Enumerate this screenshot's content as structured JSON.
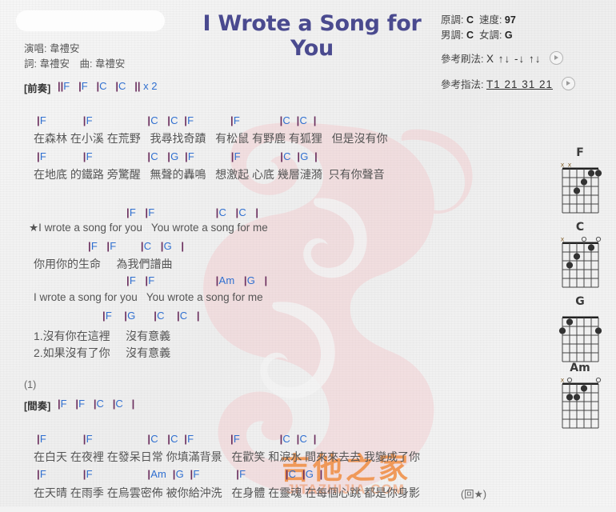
{
  "header": {
    "title": "I Wrote a Song for You",
    "singer_label": "演唱:",
    "singer": "韋禮安",
    "credits": "詞: 韋禮安　曲: 韋禮安",
    "redacted": ""
  },
  "info": {
    "original_key_label": "原調:",
    "original_key": "C",
    "tempo_label": "速度:",
    "tempo": "97",
    "male_key_label": "男調:",
    "male_key": "C",
    "female_key_label": "女調:",
    "female_key": "G",
    "strum_label": "參考刷法:",
    "strum_pattern": "X ↑↓ -↓ ↑↓",
    "pick_label": "參考指法:",
    "pick_pattern": "T1 21 31 21",
    "play_icon": "play-icon"
  },
  "sections": {
    "intro_tag": "[前奏]",
    "intro_chords": "||F   |F   |C   |C   || x 2",
    "interlude_tag": "[間奏]",
    "interlude_chords": "|F   |F   |C   |C   |",
    "repeat_note": "(1)",
    "return_note": "(回★)"
  },
  "verse1": {
    "line1_chords": "|F            |F                  |C   |C  |F            |F             |C  |C  |",
    "line1_lyric": "在森林 在小溪 在荒野   我尋找奇蹟   有松鼠 有野鹿 有狐狸   但是沒有你",
    "line2_chords": "|F            |F                  |C   |G  |F            |F             |C  |G  |",
    "line2_lyric": "在地底 的鐵路 旁驚醒   無聲的轟鳴   想激起 心底 幾層漣漪  只有你聲音"
  },
  "chorus": {
    "line1_chords": "|F   |F                    |C   |C   |",
    "line1_lyric": "★I wrote a song for you   You wrote a song for me",
    "line2_chords": "|F   |F        |C   |G   |",
    "line2_lyric": "你用你的生命     為我們譜曲",
    "line3_chords": "|F   |F                    |Am   |G   |",
    "line3_lyric": "I wrote a song for you   You wrote a song for me",
    "line4_chords": "|F    |G      |C    |C   |",
    "line4_lyric1": "1.沒有你在這裡     沒有意義",
    "line4_lyric2": "2.如果沒有了你     沒有意義"
  },
  "verse3": {
    "line1_chords": "|F            |F                  |C   |C  |F            |F             |C  |C  |",
    "line1_lyric": "在白天 在夜裡 在發呆日常 你填滿背景   在歡笑 和淚水 間來來去去 我變成了你",
    "line2_chords": "|F            |F                  |Am  |G  |F            |F             |C  |G  |",
    "line2_lyric": "在天晴 在雨季 在烏雲密佈 被你給沖洗   在身體 在靈魂 在每個心跳 都是你身影"
  },
  "chord_diagrams": [
    {
      "name": "F",
      "markers": [
        "x",
        "x",
        "",
        "",
        "",
        ""
      ],
      "dots": [
        {
          "string": 3,
          "fret": 3
        },
        {
          "string": 4,
          "fret": 2
        },
        {
          "string": 5,
          "fret": 1
        },
        {
          "string": 6,
          "fret": 1
        }
      ]
    },
    {
      "name": "C",
      "markers": [
        "x",
        "",
        "",
        "o",
        "",
        "o"
      ],
      "dots": [
        {
          "string": 2,
          "fret": 3
        },
        {
          "string": 3,
          "fret": 2
        },
        {
          "string": 5,
          "fret": 1
        }
      ]
    },
    {
      "name": "G",
      "markers": [
        "",
        "",
        "",
        "",
        "",
        ""
      ],
      "dots": [
        {
          "string": 1,
          "fret": 2
        },
        {
          "string": 2,
          "fret": 1
        },
        {
          "string": 6,
          "fret": 2
        }
      ]
    },
    {
      "name": "Am",
      "markers": [
        "x",
        "o",
        "",
        "",
        "",
        "o"
      ],
      "dots": [
        {
          "string": 2,
          "fret": 2
        },
        {
          "string": 3,
          "fret": 2
        },
        {
          "string": 4,
          "fret": 1
        }
      ]
    }
  ],
  "watermark": {
    "brand_cn": "吉他之家",
    "brand_url": "JITAZHIJIA.COM",
    "seahorse": "seahorse-logo"
  }
}
